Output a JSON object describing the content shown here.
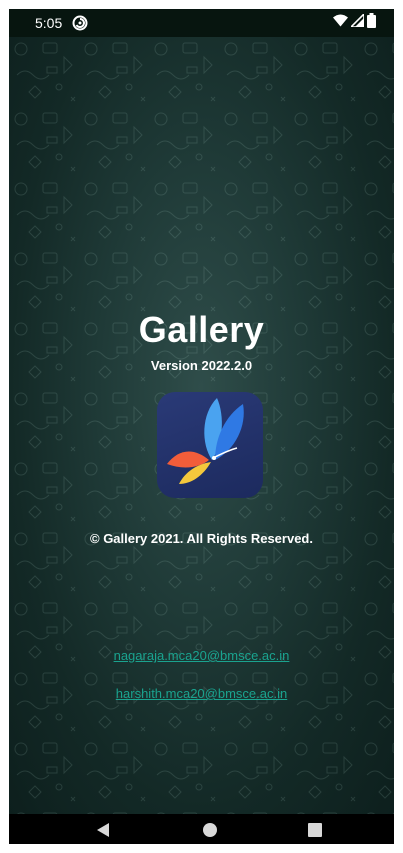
{
  "status_bar": {
    "time": "5:05",
    "app_icon": "sync-circle-icon",
    "icons": [
      "wifi-icon",
      "cellular-signal-icon",
      "battery-icon"
    ]
  },
  "about": {
    "title": "Gallery",
    "version": "Version 2022.2.0",
    "logo": "butterfly-logo",
    "copyright": "© Gallery 2021. All Rights Reserved.",
    "emails": [
      "nagaraja.mca20@bmsce.ac.in",
      "harshith.mca20@bmsce.ac.in"
    ]
  },
  "nav_bar": {
    "buttons": [
      "back-icon",
      "home-icon",
      "recents-icon"
    ]
  },
  "colors": {
    "background": "#1f3a37",
    "link": "#1aa38f",
    "logo_background": "#2a3a77",
    "status_bar": "#07150f"
  }
}
